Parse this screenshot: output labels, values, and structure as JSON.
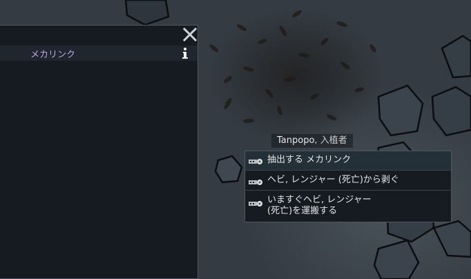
{
  "panel": {
    "row_label": "メカリンク"
  },
  "pawn_label": {
    "name": "Tanpopo",
    "faction": ", 入植者"
  },
  "menu": {
    "items": [
      {
        "label": "抽出する メカリンク",
        "icon": "mechlink-icon"
      },
      {
        "label": "ヘビ, レンジャー (死亡)から剥ぐ",
        "icon": "strip-icon"
      },
      {
        "label": "いますぐヘビ, レンジャー\n(死亡)を運搬する",
        "icon": "haul-icon"
      }
    ]
  }
}
